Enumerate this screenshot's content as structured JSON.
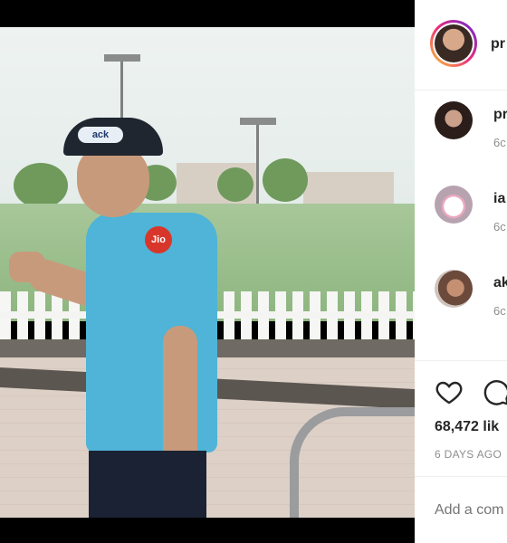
{
  "post": {
    "header_username": "pr",
    "comments": [
      {
        "username": "pr",
        "time": "6c",
        "avatar_color": "#2a1d1a"
      },
      {
        "username": "ia",
        "time": "6c",
        "avatar_color": "#e9dfe4"
      },
      {
        "username": "ak",
        "time": "6c",
        "avatar_color": "#6b4a3c"
      }
    ],
    "likes": "68,472 lik",
    "time_ago": "6 DAYS AGO",
    "add_comment_placeholder": "Add a com"
  },
  "photo": {
    "cap_text": "ack",
    "jersey_logo": "Jio"
  },
  "icons": {
    "like": "heart-icon",
    "comment": "comment-icon"
  }
}
